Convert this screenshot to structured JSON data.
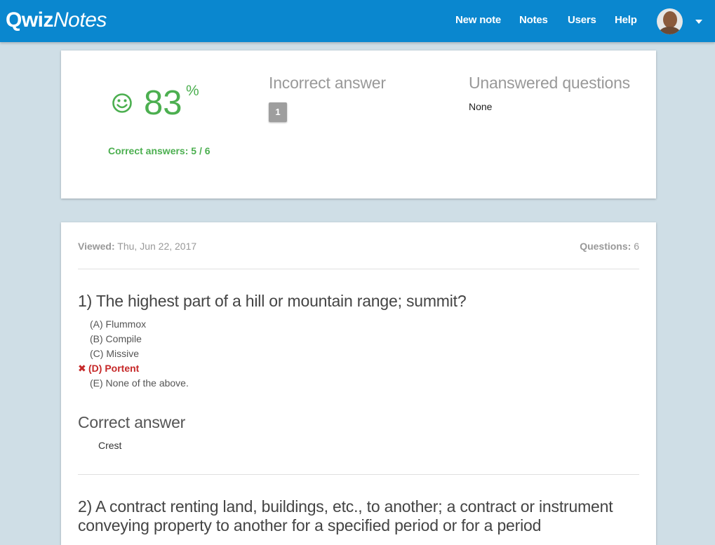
{
  "brand": {
    "bold": "Qwiz",
    "italic": "Notes"
  },
  "nav": {
    "new_note": "New note",
    "notes": "Notes",
    "users": "Users",
    "help": "Help"
  },
  "colors": {
    "navbar": "#0a87cf",
    "score": "#4caf50",
    "wrong": "#c62828",
    "background": "#cfdee6"
  },
  "results": {
    "score": "83",
    "score_unit": "%",
    "correct_answers": "Correct answers: 5 / 6",
    "incorrect_heading": "Incorrect answer",
    "incorrect_items": [
      "1"
    ],
    "unanswered_heading": "Unanswered questions",
    "unanswered_value": "None"
  },
  "quiz": {
    "viewed_label": "Viewed:",
    "viewed_value": "Thu, Jun 22, 2017",
    "questions_label": "Questions:",
    "questions_value": "6",
    "q1": {
      "text": "1) The highest part of a hill or mountain range; summit?",
      "choices": {
        "a": "(A) Flummox",
        "b": "(B) Compile",
        "c": "(C) Missive",
        "d": "(D) Portent",
        "e": "(E) None of the above."
      },
      "wrong_mark": "✖",
      "correct_heading": "Correct answer",
      "correct_value": "Crest"
    },
    "q2": {
      "text": "2) A contract renting land, buildings, etc., to another; a contract or instrument conveying property to another for a specified period or for a period"
    }
  }
}
